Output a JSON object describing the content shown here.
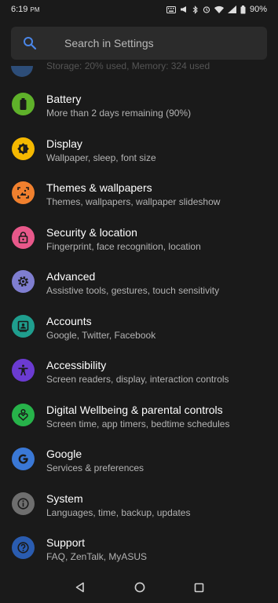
{
  "status_bar": {
    "time": "6:19",
    "ampm": "PM",
    "battery": "90%"
  },
  "search": {
    "placeholder": "Search in Settings",
    "icon": "search-icon"
  },
  "partial_item": {
    "subtitle": "Storage: 20% used, Memory: 324 used"
  },
  "settings": [
    {
      "title": "Battery",
      "subtitle": "More than 2 days remaining (90%)",
      "icon": "battery-icon",
      "color": "#5fb12a"
    },
    {
      "title": "Display",
      "subtitle": "Wallpaper, sleep, font size",
      "icon": "brightness-icon",
      "color": "#f5b800"
    },
    {
      "title": "Themes & wallpapers",
      "subtitle": "Themes, wallpapers, wallpaper slideshow",
      "icon": "wallpaper-icon",
      "color": "#f0802e"
    },
    {
      "title": "Security & location",
      "subtitle": "Fingerprint, face recognition, location",
      "icon": "lock-icon",
      "color": "#e8588a"
    },
    {
      "title": "Advanced",
      "subtitle": "Assistive tools, gestures, touch sensitivity",
      "icon": "gear-icon",
      "color": "#7f7ed0"
    },
    {
      "title": "Accounts",
      "subtitle": "Google, Twitter, Facebook",
      "icon": "account-icon",
      "color": "#1f9e8e"
    },
    {
      "title": "Accessibility",
      "subtitle": "Screen readers, display, interaction controls",
      "icon": "accessibility-icon",
      "color": "#6b3bd1"
    },
    {
      "title": "Digital Wellbeing & parental controls",
      "subtitle": "Screen time, app timers, bedtime schedules",
      "icon": "wellbeing-icon",
      "color": "#27b34a"
    },
    {
      "title": "Google",
      "subtitle": "Services & preferences",
      "icon": "google-icon",
      "color": "#3a78d6"
    },
    {
      "title": "System",
      "subtitle": "Languages, time, backup, updates",
      "icon": "info-icon",
      "color": "#6e6e6e"
    },
    {
      "title": "Support",
      "subtitle": "FAQ, ZenTalk, MyASUS",
      "icon": "help-icon",
      "color": "#2a5cb0"
    }
  ],
  "navigation": {
    "back": "back-icon",
    "home": "home-icon",
    "recents": "recents-icon"
  }
}
